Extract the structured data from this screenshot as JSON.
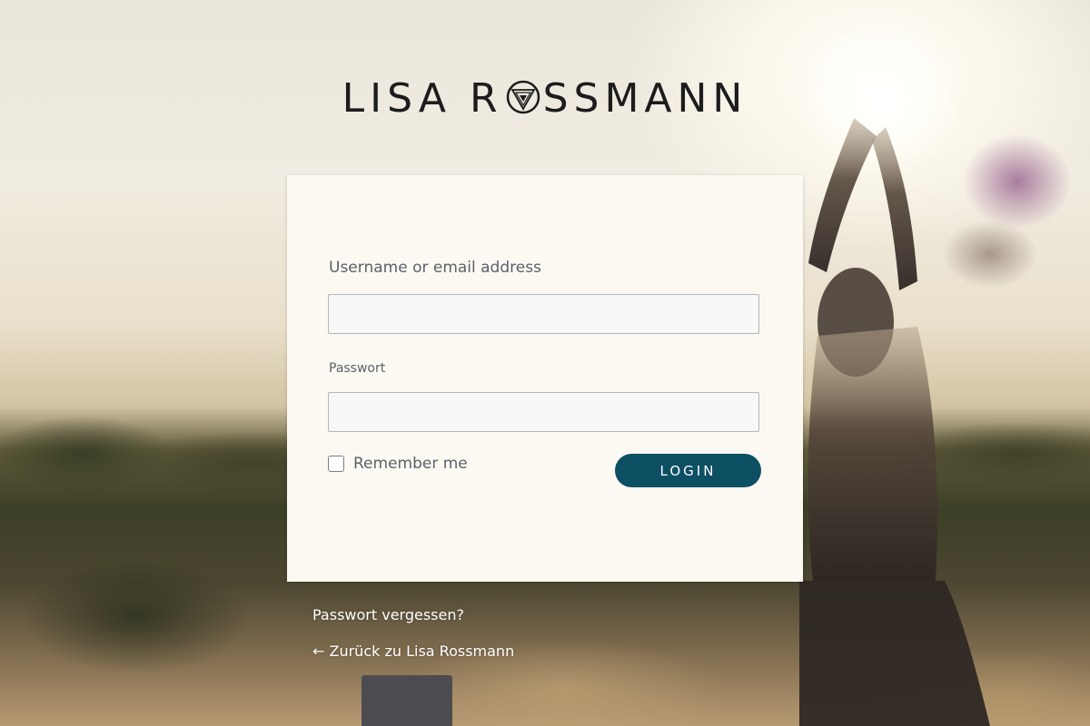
{
  "brand": {
    "logo_text_left": "LISA R",
    "logo_text_right": "SSMANN"
  },
  "login_form": {
    "username_label": "Username or email address",
    "username_value": "",
    "password_label": "Passwort",
    "password_value": "",
    "remember_label": "Remember me",
    "remember_checked": false,
    "submit_label": "LOGIN"
  },
  "links": {
    "forgot_password": "Passwort vergessen?",
    "back_to_site": "← Zurück zu Lisa Rossmann"
  },
  "colors": {
    "primary_button": "#0d4f63",
    "card_background": "#fcf9f3",
    "label_text": "#5d6168"
  }
}
